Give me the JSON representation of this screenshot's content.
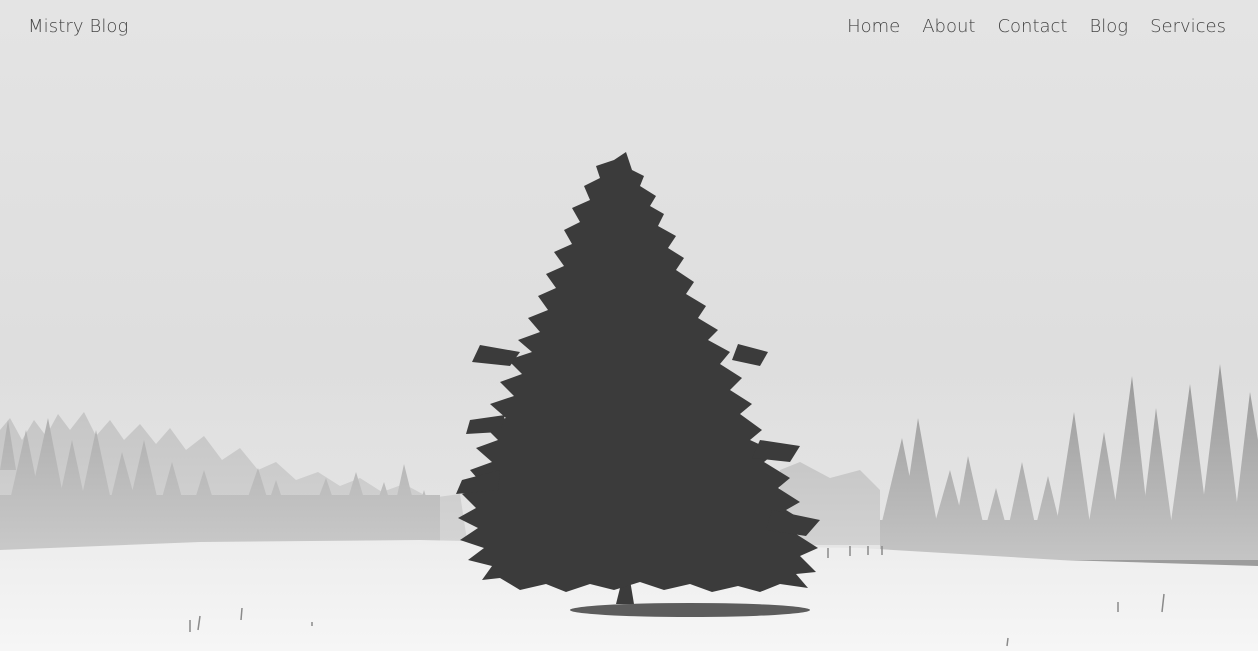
{
  "site": {
    "brand": "Mistry Blog"
  },
  "nav": {
    "items": [
      {
        "label": "Home"
      },
      {
        "label": "About"
      },
      {
        "label": "Contact"
      },
      {
        "label": "Blog"
      },
      {
        "label": "Services"
      }
    ]
  },
  "colors": {
    "text": "#444444",
    "sky": "#e3e3e3",
    "snow": "#f4f4f4",
    "tree": "#3a3a3a",
    "forest_far": "#b4b4b4",
    "forest_near": "#9a9a9a"
  },
  "hero": {
    "image": "foggy-winter-field-with-lone-pine-tree"
  }
}
